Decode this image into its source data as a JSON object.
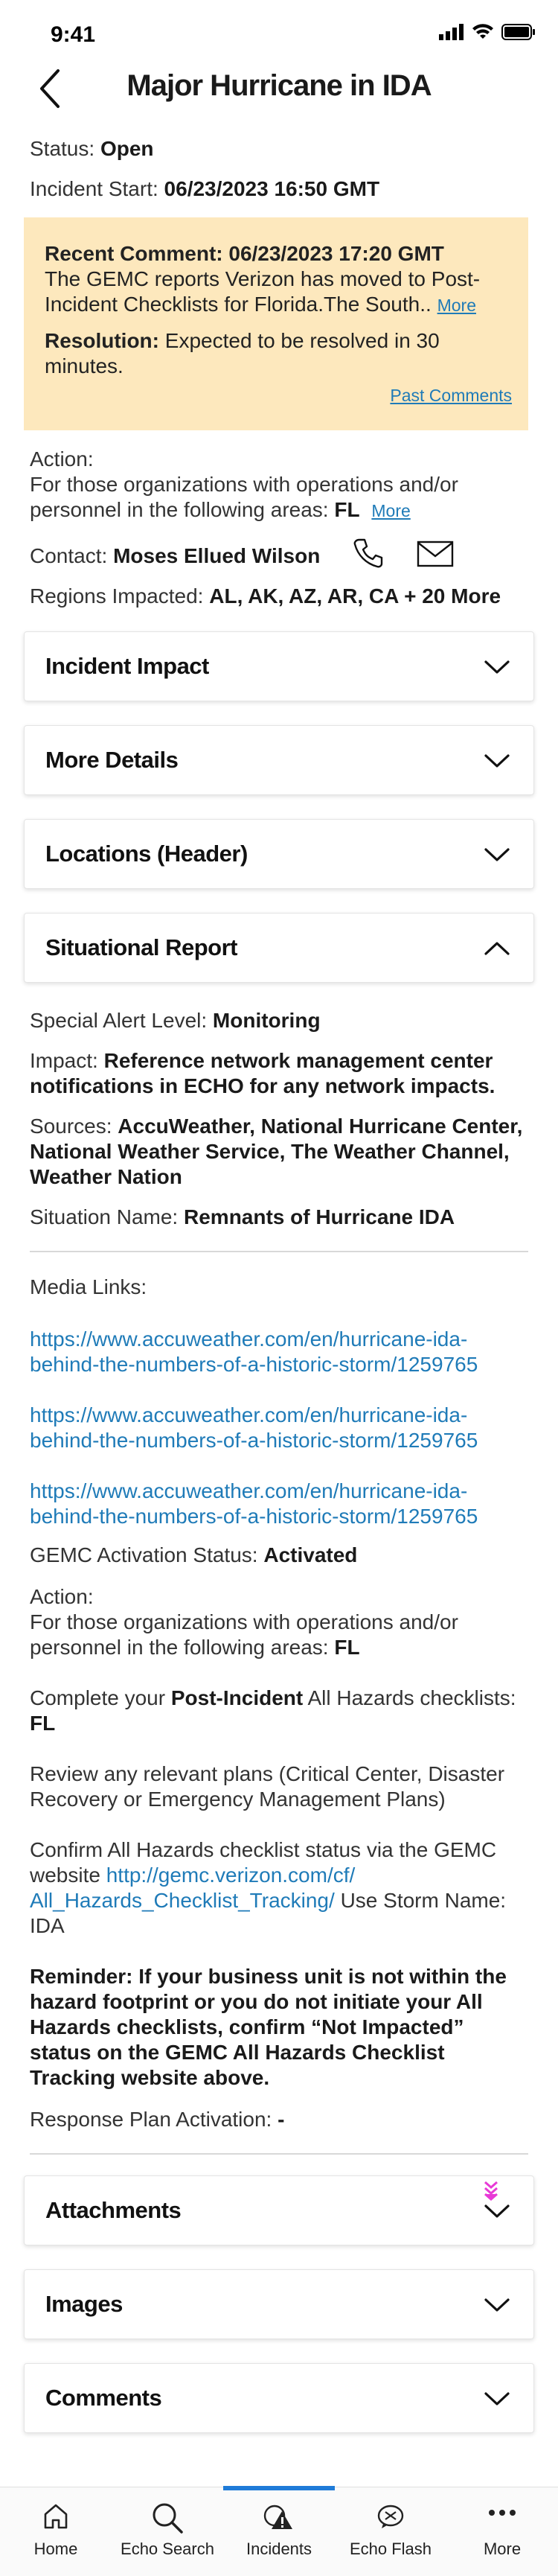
{
  "statusbar": {
    "time": "9:41"
  },
  "header": {
    "title": "Major Hurricane in IDA"
  },
  "incident": {
    "status_label": "Status:",
    "status_value": "Open",
    "start_label": "Incident Start:",
    "start_value": "06/23/2023 16:50 GMT"
  },
  "comment": {
    "heading": "Recent Comment: 06/23/2023 17:20 GMT",
    "text_line1": "The GEMC reports Verizon has moved to Post-",
    "text_line2": "Incident Checklists for Florida.The South..",
    "more": "More",
    "resolution_label": "Resolution:",
    "resolution_line1": "Expected to be resolved in 30",
    "resolution_line2": "minutes.",
    "past_comments": "Past Comments"
  },
  "action": {
    "label": "Action:",
    "line1": "For those organizations with operations and/or",
    "line2": "personnel in the following areas:",
    "areas": "FL",
    "more": "More"
  },
  "contact": {
    "label": "Contact:",
    "name": "Moses Ellued Wilson"
  },
  "regions": {
    "label": "Regions Impacted:",
    "value": "AL, AK, AZ, AR, CA + 20 More"
  },
  "sections": {
    "incident_impact": "Incident Impact",
    "more_details": "More Details",
    "locations": "Locations (Header)",
    "situational_report": "Situational Report",
    "attachments": "Attachments",
    "images": "Images",
    "comments": "Comments"
  },
  "situational": {
    "alert_label": "Special Alert Level:",
    "alert_value": "Monitoring",
    "impact_label": "Impact:",
    "impact_line1": "Reference network management center",
    "impact_line2": "notifications in ECHO for any network impacts.",
    "sources_label": "Sources:",
    "sources_line1": "AccuWeather, National Hurricane Center,",
    "sources_line2": "National Weather Service, The Weather Channel,",
    "sources_line3": "Weather Nation",
    "situation_label": "Situation Name:",
    "situation_value": "Remnants of Hurricane IDA",
    "media_label": "Media Links:",
    "media_links": [
      {
        "line1": "https://www.accuweather.com/en/hurricane-ida-",
        "line2": "behind-the-numbers-of-a-historic-storm/1259765"
      },
      {
        "line1": "https://www.accuweather.com/en/hurricane-ida-",
        "line2": "behind-the-numbers-of-a-historic-storm/1259765"
      },
      {
        "line1": "https://www.accuweather.com/en/hurricane-ida-",
        "line2": "behind-the-numbers-of-a-historic-storm/1259765"
      }
    ],
    "gemc_label": "GEMC Activation Status:",
    "gemc_value": "Activated",
    "action_label": "Action:",
    "action_line1": "For those organizations with operations and/or",
    "action_line2": "personnel in the following areas:",
    "action_areas": "FL",
    "complete_prefix": "Complete your",
    "complete_bold": "Post-Incident",
    "complete_suffix": "All Hazards checklists:",
    "complete_areas": "FL",
    "review_line1": "Review any relevant plans (Critical Center, Disaster",
    "review_line2": "Recovery or Emergency Management Plans)",
    "confirm_line1": "Confirm All Hazards checklist status via the GEMC",
    "confirm_prefix": "website",
    "confirm_link1": "http://gemc.verizon.com/cf/",
    "confirm_link2": "All_Hazards_Checklist_Tracking/",
    "confirm_suffix": "Use Storm Name:",
    "confirm_storm": "IDA",
    "reminder_line1": "Reminder: If your business unit is not within the",
    "reminder_line2": "hazard footprint or you do not initiate your All",
    "reminder_line3": "Hazards checklists, confirm “Not Impacted”",
    "reminder_line4": "status on the GEMC All Hazards Checklist",
    "reminder_line5": "Tracking website above.",
    "response_label": "Response Plan Activation:",
    "response_value": "-"
  },
  "tabbar": {
    "items": [
      {
        "label": "Home",
        "icon": "home-icon"
      },
      {
        "label": "Echo Search",
        "icon": "search-icon"
      },
      {
        "label": "Incidents",
        "icon": "incident-alert-icon"
      },
      {
        "label": "Echo Flash",
        "icon": "flash-icon"
      },
      {
        "label": "More",
        "icon": "more-dots-icon"
      }
    ],
    "active": "Incidents"
  },
  "colors": {
    "accent": "#1f7bb8",
    "comment_bg": "#fde8bd",
    "tab_active": "#1f7bd8",
    "scroll_marker": "#e83ad6"
  }
}
